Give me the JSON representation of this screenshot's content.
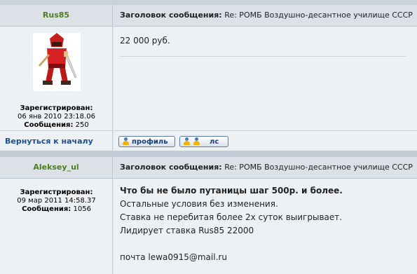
{
  "posts": [
    {
      "author": "Rus85",
      "subject_label": "Заголовок сообщения:",
      "subject_text": "Re: РОМБ Воздушно-десантное училище СССР",
      "reg_label": "Зарегистрирован:",
      "reg_date": "06 янв 2010 23:18.06",
      "posts_label": "Сообщения:",
      "posts_count": "250",
      "message": [
        "22 000 руб."
      ]
    },
    {
      "author": "Aleksey_ul",
      "subject_label": "Заголовок сообщения:",
      "subject_text": "Re: РОМБ Воздушно-десантное училище СССР",
      "reg_label": "Зарегистрирован:",
      "reg_date": "09 мар 2011 14:58.37",
      "posts_label": "Сообщения:",
      "posts_count": "1056",
      "message": [
        "Что бы не было путаницы шаг 500р. и более.",
        "Остальные условия без изменения.",
        "Ставка не перебитая более 2х суток выигрывает.",
        "Лидирует ставка Rus85 22000",
        "",
        "почта lewa0915@mail.ru"
      ]
    }
  ],
  "back_to_top": "Вернуться к началу",
  "buttons": {
    "profile": "профиль",
    "pm": "лс"
  },
  "colors": {
    "author": "#4d7f1e",
    "link": "#1c4f8c",
    "header_bg": "#dbe1e7",
    "body_bg": "#eef1f4"
  }
}
